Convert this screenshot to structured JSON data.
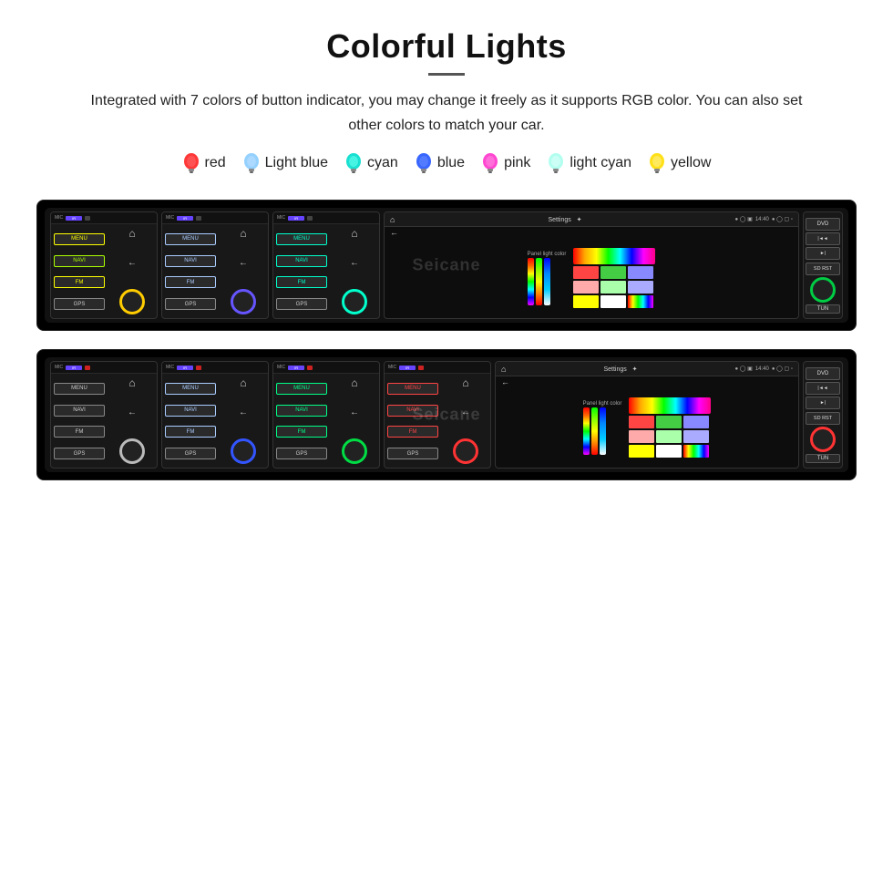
{
  "page": {
    "title": "Colorful Lights",
    "description": "Integrated with 7 colors of button indicator, you may change it freely as it supports RGB color. You can also set other colors to match your car.",
    "colors": [
      {
        "name": "red",
        "hex": "#ff2222",
        "glow": "#ff0000"
      },
      {
        "name": "Light blue",
        "hex": "#88ccff",
        "glow": "#66aaff"
      },
      {
        "name": "cyan",
        "hex": "#00ffee",
        "glow": "#00ffcc"
      },
      {
        "name": "blue",
        "hex": "#2244ff",
        "glow": "#3355ff"
      },
      {
        "name": "pink",
        "hex": "#ff44cc",
        "glow": "#ff33bb"
      },
      {
        "name": "light cyan",
        "hex": "#aaffee",
        "glow": "#88ffee"
      },
      {
        "name": "yellow",
        "hex": "#ffdd00",
        "glow": "#ffcc00"
      }
    ],
    "unit_buttons": [
      "MENU",
      "NAVI",
      "FM",
      "GPS"
    ],
    "right_buttons": [
      "DVD",
      "SD\nRST",
      "TUN"
    ],
    "display_title": "Settings",
    "panel_label": "Panel light color",
    "watermark": "Seicane"
  }
}
